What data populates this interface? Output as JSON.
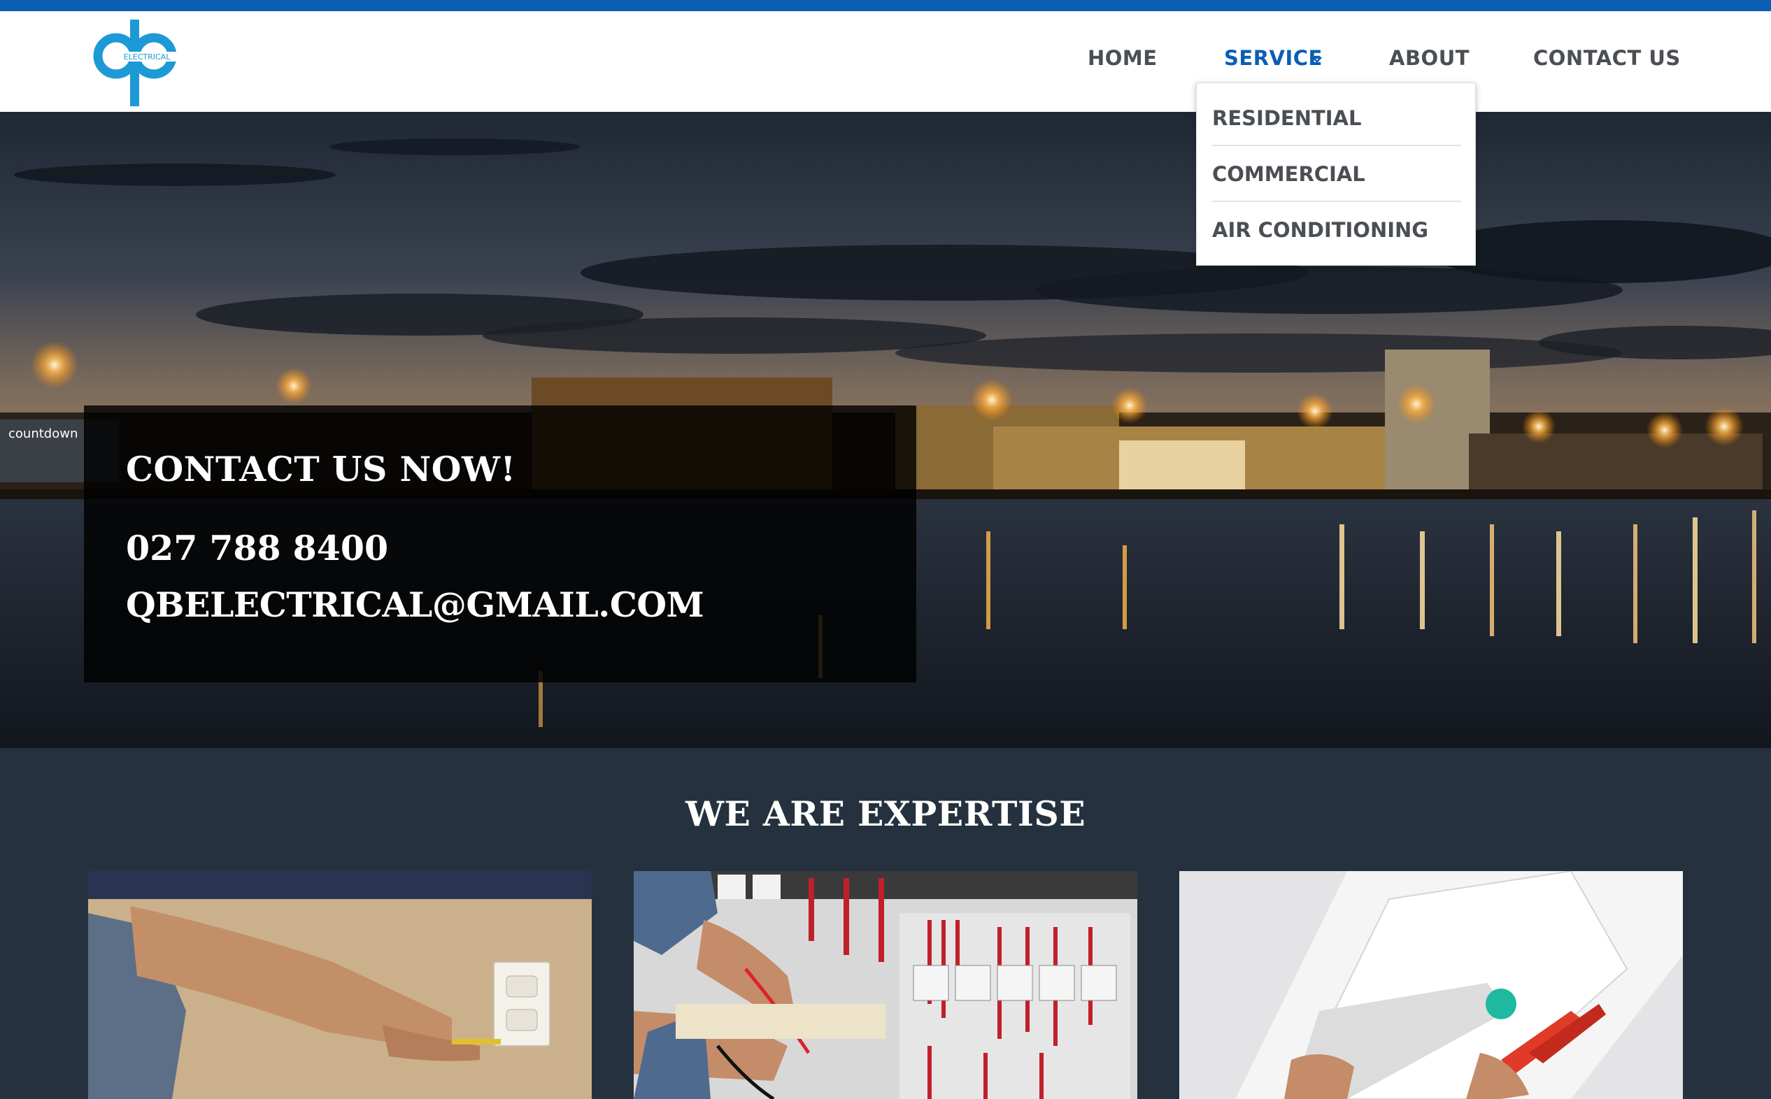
{
  "brand": {
    "logo_letters": "qb",
    "logo_subtext": "ELECTRICAL",
    "logo_color": "#1d9ad6",
    "accent_color": "#0a5fb4"
  },
  "nav": {
    "home": "HOME",
    "service": "SERVICE",
    "about": "ABOUT",
    "contact": "CONTACT US",
    "active": "SERVICE"
  },
  "service_menu": {
    "items": [
      "RESIDENTIAL",
      "COMMERCIAL",
      "AIR CONDITIONING"
    ]
  },
  "hero": {
    "sign_text": "countdown",
    "contact_title": "CONTACT US NOW!",
    "phone": "027 788 8400",
    "email": "QBELECTRICAL@GMAIL.COM"
  },
  "expertise": {
    "title": "WE ARE EXPERTISE",
    "cards": [
      {
        "name": "residential-outlet-image"
      },
      {
        "name": "commercial-panel-image"
      },
      {
        "name": "air-conditioning-image"
      }
    ]
  }
}
